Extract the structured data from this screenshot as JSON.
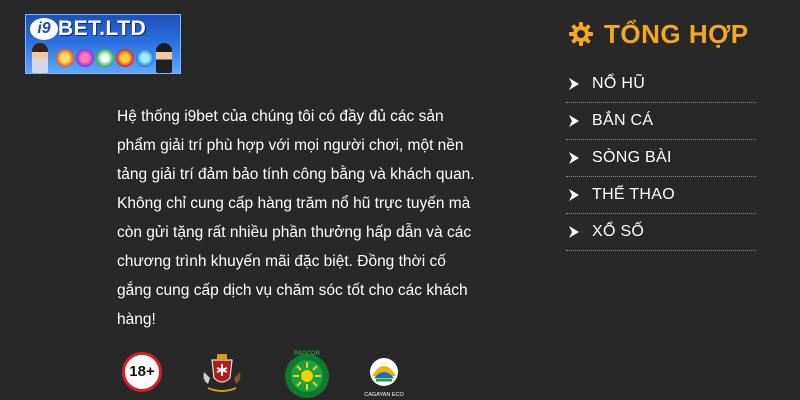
{
  "logo": {
    "text": "BET.LTD",
    "badge": "i9"
  },
  "description": "Hệ thống i9bet của chúng tôi có đầy đủ các sản phẩm giải trí phù hợp với mọi người chơi, một nền tảng giải trí đảm bảo tính công bằng và khách quan. Không chỉ cung cấp hàng trăm nổ hũ trực tuyến mà còn gửi tặng rất nhiều phần thưởng hấp dẫn và các chương trình khuyến mãi đặc biệt. Đồng thời cố gắng cung cấp dịch vụ chăm sóc tốt cho các khách hàng!",
  "badges": {
    "age": "18+",
    "pagcor": "PAGCOR",
    "cagayan": "CAGAYAN ECO"
  },
  "sidebar": {
    "title": "TỔNG HỢP",
    "items": [
      {
        "label": "NỔ HŨ"
      },
      {
        "label": "BẮN CÁ"
      },
      {
        "label": "SÒNG BÀI"
      },
      {
        "label": "THỂ THAO"
      },
      {
        "label": "XỔ SỐ"
      }
    ]
  },
  "colors": {
    "background": "#282828",
    "accent": "#f5a623",
    "text": "#ffffff",
    "logo_blue": "#1d4fb8"
  },
  "icons": {
    "title": "gear-icon",
    "items": "chevron-right-icon"
  }
}
